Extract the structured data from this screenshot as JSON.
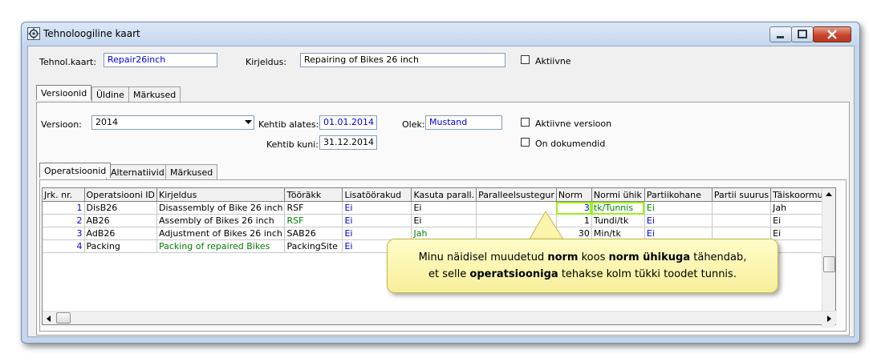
{
  "window": {
    "title": "Tehnoloogiline kaart"
  },
  "header": {
    "tehnol_label": "Tehnol.kaart:",
    "tehnol_value": "Repair26inch",
    "kirjeldus_label": "Kirjeldus:",
    "kirjeldus_value": "Repairing of Bikes 26 inch",
    "aktiivne_label": "Aktiivne"
  },
  "tabs": [
    "Versioonid",
    "Üldine",
    "Märkused"
  ],
  "version": {
    "version_label": "Versioon:",
    "version_value": "2014",
    "kehtib_alates_label": "Kehtib alates:",
    "kehtib_alates_value": "01.01.2014",
    "kehtib_kuni_label": "Kehtib kuni:",
    "kehtib_kuni_value": "31.12.2014",
    "olek_label": "Olek:",
    "olek_value": "Mustand",
    "aktiivne_versioon_label": "Aktiivne versioon",
    "on_dokumendid_label": "On dokumendid"
  },
  "subtabs": [
    "Operatsioonid",
    "Alternatiivid",
    "Märkused"
  ],
  "grid": {
    "columns": [
      "Jrk. nr.",
      "Operatsiooni ID",
      "Kirjeldus",
      "Tööräkk",
      "Lisatöörakud",
      "Kasuta parall.",
      "Paralleelsustegur",
      "Norm",
      "Normi ühik",
      "Partiikohane",
      "Partii suurus",
      "Täiskoormus"
    ],
    "rows": [
      [
        "1",
        "DisB26",
        "Disassembly of Bike 26 inch",
        "RSF",
        "Ei",
        "Ei",
        "",
        "3",
        "tk/Tunnis",
        "Ei",
        "",
        "Jah"
      ],
      [
        "2",
        "AB26",
        "Assembly of Bikes 26 inch",
        "RSF",
        "Ei",
        "Ei",
        "",
        "1",
        "Tundi/tk",
        "Ei",
        "",
        "Ei"
      ],
      [
        "3",
        "AdB26",
        "Adjustment of Bikes 26 inch",
        "SAB26",
        "Ei",
        "Jah",
        "",
        "30",
        "Min/tk",
        "Ei",
        "",
        "Ei"
      ],
      [
        "4",
        "Packing",
        "Packing of repaired Bikes",
        "PackingSite",
        "Ei",
        "",
        "",
        "",
        "",
        "",
        "",
        ""
      ]
    ]
  },
  "callout": {
    "part1": "Minu näidisel muudetud ",
    "bold1": "norm",
    "part2": " koos ",
    "bold2": "norm ühikuga",
    "part3": " tähendab,",
    "part4": "et selle ",
    "bold3": "operatsiooniga",
    "part5": " tehakse kolm tükki toodet tunnis."
  }
}
